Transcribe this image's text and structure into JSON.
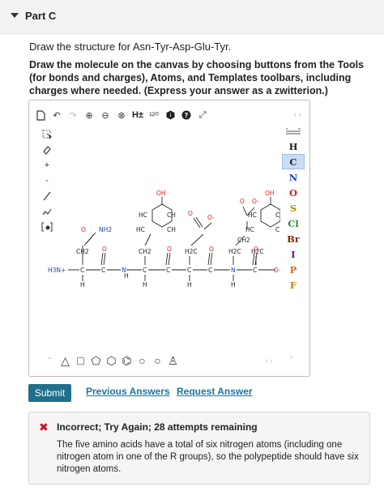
{
  "part": {
    "title": "Part C"
  },
  "question": {
    "text": "Draw the structure for Asn-Tyr-Asp-Glu-Tyr."
  },
  "instructions": {
    "text": "Draw the molecule on the canvas by choosing buttons from the Tools (for bonds and charges), Atoms, and Templates toolbars, including charges where needed. (Express your answer as a zwitterion.)"
  },
  "top_toolbar": {
    "charge_label": "H±",
    "isotope_label": "¹²⁰"
  },
  "left_toolbar": [
    "select",
    "erase",
    "+",
    "-",
    "bond",
    "chain",
    "bracket"
  ],
  "elements": [
    {
      "symbol": "H",
      "color": "#222222",
      "selected": false
    },
    {
      "symbol": "C",
      "color": "#222222",
      "selected": true
    },
    {
      "symbol": "N",
      "color": "#1f3fbf",
      "selected": false
    },
    {
      "symbol": "O",
      "color": "#d42020",
      "selected": false
    },
    {
      "symbol": "S",
      "color": "#b8860b",
      "selected": false
    },
    {
      "symbol": "Cl",
      "color": "#2e8b2e",
      "selected": false
    },
    {
      "symbol": "Br",
      "color": "#8b2500",
      "selected": false
    },
    {
      "symbol": "I",
      "color": "#8b008b",
      "selected": false
    },
    {
      "symbol": "P",
      "color": "#d2691e",
      "selected": false
    },
    {
      "symbol": "F",
      "color": "#b8860b",
      "selected": false
    }
  ],
  "molecule_labels": {
    "oh1": "OH",
    "oh2": "OH",
    "nh2": "NH2",
    "h3n": "H3N+",
    "o_minus": "O-",
    "o": "O",
    "hc": "HC",
    "ch": "CH",
    "ch2": "CH2",
    "h2c": "H2C",
    "c": "C",
    "n": "N",
    "h": "H"
  },
  "actions": {
    "submit": "Submit",
    "previous": "Previous Answers",
    "request": "Request Answer"
  },
  "feedback": {
    "title": "Incorrect; Try Again; 28 attempts remaining",
    "message": "The five amino acids have a total of six nitrogen atoms (including one nitrogen atom in one of the R groups), so the polypeptide should have six nitrogen atoms."
  },
  "colors": {
    "accent": "#1f6f8b",
    "link": "#1b74a5",
    "error": "#c8102e"
  }
}
